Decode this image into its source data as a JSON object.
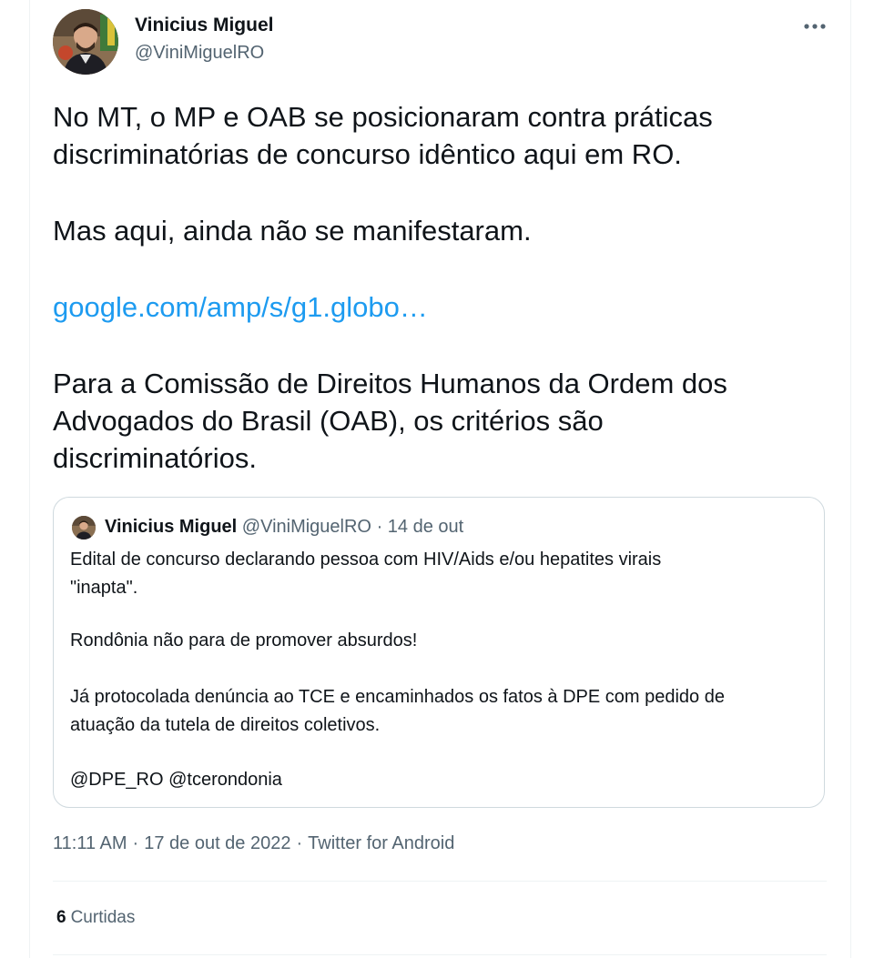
{
  "author": {
    "name": "Vinicius Miguel",
    "handle": "@ViniMiguelRO"
  },
  "tweet": {
    "paragraph_1_line_1": "No MT, o MP e OAB se posicionaram contra práticas",
    "paragraph_1_line_2": "discriminatórias de concurso idêntico aqui em RO.",
    "paragraph_2": "Mas aqui, ainda não se manifestaram.",
    "link_text": "google.com/amp/s/g1.globo…",
    "paragraph_3_line_1": "Para a Comissão de Direitos Humanos da Ordem dos",
    "paragraph_3_line_2": "Advogados do Brasil (OAB), os critérios são",
    "paragraph_3_line_3": "discriminatórios."
  },
  "quoted_tweet": {
    "name": "Vinicius Miguel",
    "handle": "@ViniMiguelRO",
    "separator": "·",
    "date": "14 de out",
    "line_1": "Edital de concurso declarando pessoa com HIV/Aids e/ou hepatites virais",
    "line_2": "\"inapta\".",
    "line_3": "Rondônia não para de promover absurdos!",
    "line_4": "Já protocolada denúncia ao TCE e encaminhados os fatos à DPE com pedido de",
    "line_5": "atuação da tutela de direitos coletivos.",
    "line_6": "@DPE_RO @tcerondonia"
  },
  "meta": {
    "time": "11:11 AM",
    "separator": "·",
    "date": "17 de out de 2022",
    "source": "Twitter for Android"
  },
  "stats": {
    "likes_count": "6",
    "likes_label": "Curtidas"
  },
  "icons": {
    "more": "more-horizontal-icon"
  },
  "colors": {
    "link": "#1d9bf0",
    "secondary_text": "#536471",
    "primary_text": "#0f1419",
    "border": "#cfd9de"
  }
}
